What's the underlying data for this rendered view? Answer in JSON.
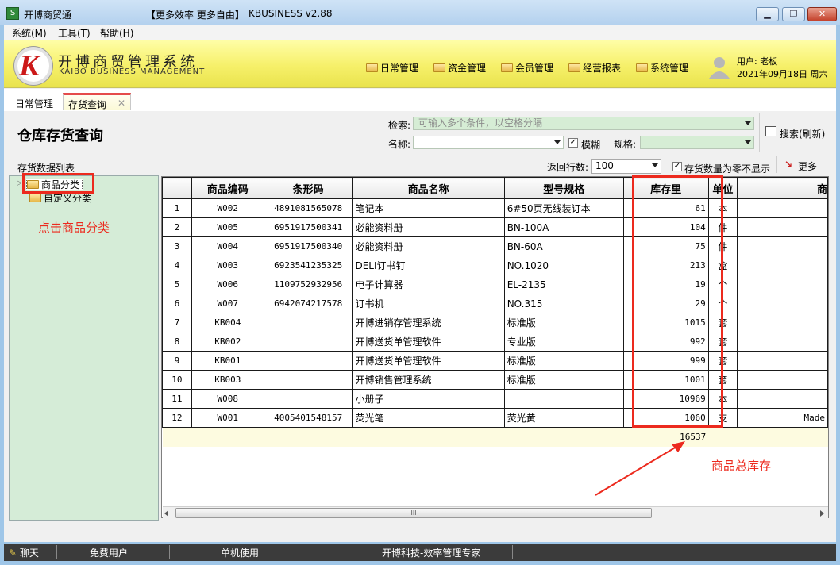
{
  "window": {
    "app_icon_glyph": "S",
    "title": "开博商贸通",
    "slogan": "【更多效率 更多自由】",
    "version": "KBUSINESS v2.88",
    "controls": {
      "minimize": "▁",
      "maximize": "❐",
      "close": "✕"
    }
  },
  "menu": {
    "items": [
      "系统(M)",
      "工具(T)",
      "帮助(H)"
    ]
  },
  "banner": {
    "logo_letter": "K",
    "brand_cn": "开博商贸管理系统",
    "brand_en": "KAIBO BUSINESS MANAGEMENT",
    "nav": [
      "日常管理",
      "资金管理",
      "会员管理",
      "经营报表",
      "系统管理"
    ],
    "user_label": "用户: 老板",
    "date_label": "2021年09月18日 周六"
  },
  "tabs": {
    "daily": "日常管理",
    "inventory": "存货查询",
    "close_glyph": "✕"
  },
  "page": {
    "title": "仓库存货查询",
    "search_label": "检索:",
    "search_placeholder": "可输入多个条件，以空格分隔",
    "name_label": "名称:",
    "name_value": "",
    "fuzzy_label": "模糊",
    "fuzzy_checked": true,
    "spec_label": "规格:",
    "spec_value": "",
    "search_button": "搜索(刷新)",
    "list_label": "存货数据列表",
    "rows_label": "返回行数:",
    "rows_value": "100",
    "zero_label": "存货数量为零不显示",
    "zero_checked": true,
    "more_button": "更多"
  },
  "tree": {
    "items": [
      "商品分类",
      "自定义分类"
    ],
    "expander": "▷"
  },
  "annotations": {
    "click_category": "点击商品分类",
    "total_stock": "商品总库存",
    "highlight_color": "#ec2a1e"
  },
  "table": {
    "columns": [
      "",
      "商品编码",
      "条形码",
      "商品名称",
      "型号规格",
      "库存里",
      "单位",
      "商"
    ],
    "rows": [
      [
        "1",
        "W002",
        "4891081565078",
        "笔记本",
        "6#50页无线装订本",
        "61",
        "本",
        ""
      ],
      [
        "2",
        "W005",
        "6951917500341",
        "必能资料册",
        "BN-100A",
        "104",
        "件",
        ""
      ],
      [
        "3",
        "W004",
        "6951917500340",
        "必能资料册",
        "BN-60A",
        "75",
        "件",
        ""
      ],
      [
        "4",
        "W003",
        "6923541235325",
        "DELI订书钉",
        "NO.1020",
        "213",
        "盒",
        ""
      ],
      [
        "5",
        "W006",
        "1109752932956",
        "电子计算器",
        "EL-2135",
        "19",
        "个",
        ""
      ],
      [
        "6",
        "W007",
        "6942074217578",
        "订书机",
        "NO.315",
        "29",
        "个",
        ""
      ],
      [
        "7",
        "KB004",
        "",
        "开博进销存管理系统",
        "标准版",
        "1015",
        "套",
        ""
      ],
      [
        "8",
        "KB002",
        "",
        "开博送货单管理软件",
        "专业版",
        "992",
        "套",
        ""
      ],
      [
        "9",
        "KB001",
        "",
        "开博送货单管理软件",
        "标准版",
        "999",
        "套",
        ""
      ],
      [
        "10",
        "KB003",
        "",
        "开博销售管理系统",
        "标准版",
        "1001",
        "套",
        ""
      ],
      [
        "11",
        "W008",
        "",
        "小册子",
        "",
        "10969",
        "本",
        ""
      ],
      [
        "12",
        "W001",
        "4005401548157",
        "荧光笔",
        "荧光黄",
        "1060",
        "支",
        "Made"
      ]
    ],
    "total": "16537"
  },
  "scrollbar": {
    "thumb_glyph": "III"
  },
  "statusbar": {
    "chat": "聊天",
    "user_type": "免费用户",
    "mode": "单机使用",
    "company": "开博科技-效率管理专家"
  }
}
